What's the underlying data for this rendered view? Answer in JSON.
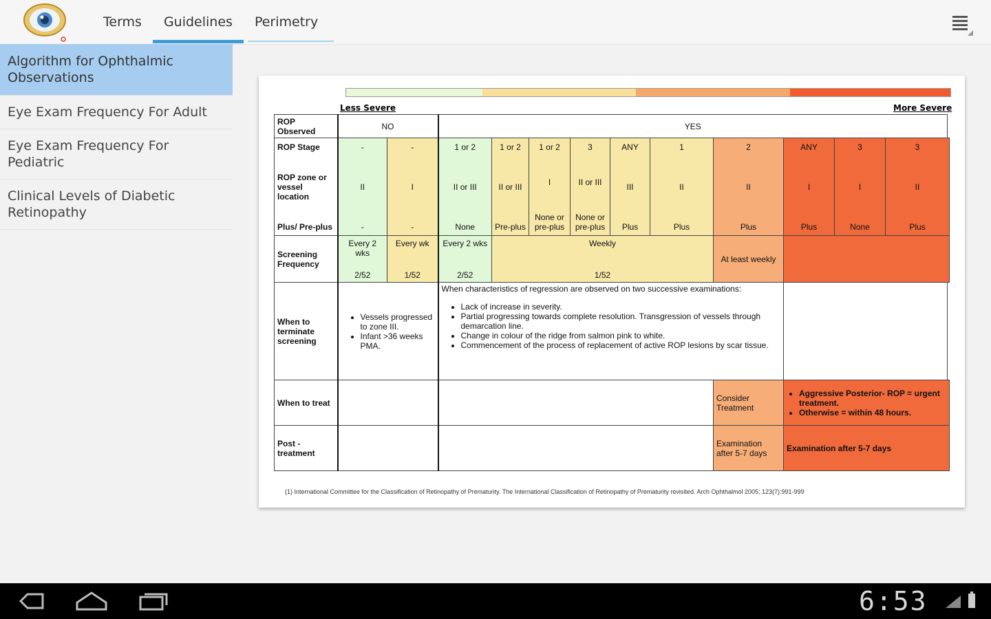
{
  "tabs": [
    {
      "label": "Terms"
    },
    {
      "label": "Guidelines"
    },
    {
      "label": "Perimetry"
    }
  ],
  "sidebar": {
    "items": [
      {
        "label": "Algorithm for Ophthalmic Observations"
      },
      {
        "label": "Eye Exam Frequency For Adult"
      },
      {
        "label": "Eye Exam Frequency For Pediatric"
      },
      {
        "label": "Clinical Levels of Diabetic Retinopathy"
      }
    ]
  },
  "chart": {
    "less_severe": "Less Severe",
    "more_severe": "More Severe",
    "row_headers": {
      "rop_observed": "ROP Observed",
      "rop_stage": "ROP Stage",
      "rop_zone": "ROP zone or vessel location",
      "plus": "Plus/ Pre-plus",
      "screening": "Screening Frequency",
      "terminate": "When to terminate screening",
      "treat": "When to treat",
      "post": "Post - treatment"
    },
    "observed": {
      "no": "NO",
      "yes": "YES"
    },
    "columns": [
      {
        "stage": "-",
        "zone": "II",
        "plus": "-"
      },
      {
        "stage": "-",
        "zone": "I",
        "plus": "-"
      },
      {
        "stage": "1 or 2",
        "zone": "II or III",
        "plus": "None"
      },
      {
        "stage": "1 or 2",
        "zone": "II or III",
        "plus": "Pre-plus"
      },
      {
        "stage": "1 or 2",
        "zone": "I",
        "plus": "None or pre-plus"
      },
      {
        "stage": "3",
        "zone": "II or III",
        "plus": "None or pre-plus"
      },
      {
        "stage": "ANY",
        "zone": "III",
        "plus": "Plus"
      },
      {
        "stage": "1",
        "zone": "II",
        "plus": "Plus"
      },
      {
        "stage": "2",
        "zone": "II",
        "plus": "Plus"
      },
      {
        "stage": "ANY",
        "zone": "I",
        "plus": "Plus"
      },
      {
        "stage": "3",
        "zone": "I",
        "plus": "None"
      },
      {
        "stage": "3",
        "zone": "II",
        "plus": "Plus"
      }
    ],
    "screening": {
      "c1_text": "Every 2 wks",
      "c1_code": "2/52",
      "c2_text": "Every wk",
      "c2_code": "1/52",
      "c3_text": "Every 2 wks",
      "c3_code": "2/52",
      "weekly_text": "Weekly",
      "weekly_code": "1/52",
      "atleast": "At least weekly"
    },
    "terminate": {
      "no_bullets": [
        "Vessels progressed to zone III.",
        "Infant >36 weeks PMA."
      ],
      "yes_intro": "When characteristics of regression are observed on two successive examinations:",
      "yes_bullets": [
        "Lack of increase in severity.",
        "Partial progressing towards complete resolution. Transgression of vessels through demarcation line.",
        "Change in colour of the ridge from salmon pink to white.",
        "Commencement of the process of replacement of active ROP lesions by scar tissue."
      ]
    },
    "treat": {
      "consider": "Consider Treatment",
      "bullets": [
        "Aggressive Posterior- ROP = urgent treatment.",
        "Otherwise = within 48 hours."
      ]
    },
    "post": {
      "exam_orange": "Examination after 5-7 days",
      "exam_red": "Examination after 5-7 days"
    },
    "footnote": "(1) International Committee for the Classification of Retinopathy of Prematurity. The International Classification of Retinopathy of Prematurity revisited. Arch Ophthalmol 2005; 123(7):991-999"
  },
  "status": {
    "clock": "6:53"
  },
  "colors": {
    "tab_accent": "#3e9bd8",
    "selected_item": "#a6cdf0",
    "green": "#e0f8d8",
    "yellow": "#f8e8a8",
    "orange": "#f6ad78",
    "red": "#f06a3c"
  },
  "icons": {
    "logo": "eye-logo-icon",
    "menu": "overflow-menu-icon",
    "back": "back-icon",
    "home": "home-icon",
    "recents": "recent-apps-icon"
  }
}
